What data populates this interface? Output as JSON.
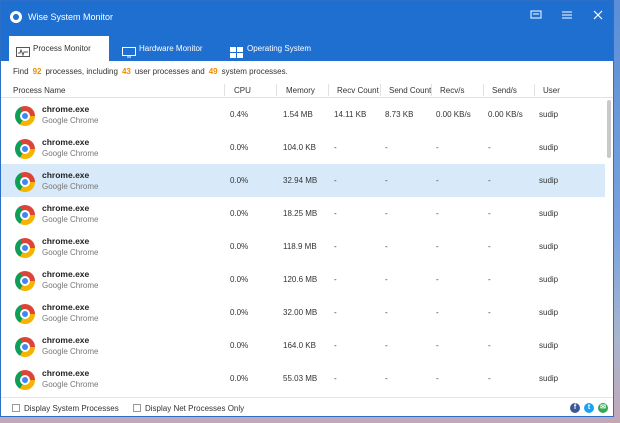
{
  "window": {
    "title": "Wise System Monitor"
  },
  "tabs": [
    {
      "label": "Process Monitor",
      "icon": "pulse-monitor-icon"
    },
    {
      "label": "Hardware Monitor",
      "icon": "computer-monitor-icon"
    },
    {
      "label": "Operating System",
      "icon": "windows-logo-icon"
    }
  ],
  "summary": {
    "prefix": "Find",
    "total": "92",
    "mid1": "processes, including",
    "user_count": "43",
    "mid2": "user processes and",
    "system_count": "49",
    "suffix": "system processes."
  },
  "columns": [
    "Process Name",
    "CPU",
    "Memory",
    "Recv Count",
    "Send Count",
    "Recv/s",
    "Send/s",
    "User"
  ],
  "processes": [
    {
      "name": "chrome.exe",
      "desc": "Google Chrome",
      "cpu": "0.4%",
      "memory": "1.54 MB",
      "recv_count": "14.11 KB",
      "send_count": "8.73 KB",
      "recv_s": "0.00 KB/s",
      "send_s": "0.00 KB/s",
      "user": "sudip"
    },
    {
      "name": "chrome.exe",
      "desc": "Google Chrome",
      "cpu": "0.0%",
      "memory": "104.0 KB",
      "recv_count": "-",
      "send_count": "-",
      "recv_s": "-",
      "send_s": "-",
      "user": "sudip"
    },
    {
      "name": "chrome.exe",
      "desc": "Google Chrome",
      "cpu": "0.0%",
      "memory": "32.94 MB",
      "recv_count": "-",
      "send_count": "-",
      "recv_s": "-",
      "send_s": "-",
      "user": "sudip"
    },
    {
      "name": "chrome.exe",
      "desc": "Google Chrome",
      "cpu": "0.0%",
      "memory": "18.25 MB",
      "recv_count": "-",
      "send_count": "-",
      "recv_s": "-",
      "send_s": "-",
      "user": "sudip"
    },
    {
      "name": "chrome.exe",
      "desc": "Google Chrome",
      "cpu": "0.0%",
      "memory": "118.9 MB",
      "recv_count": "-",
      "send_count": "-",
      "recv_s": "-",
      "send_s": "-",
      "user": "sudip"
    },
    {
      "name": "chrome.exe",
      "desc": "Google Chrome",
      "cpu": "0.0%",
      "memory": "120.6 MB",
      "recv_count": "-",
      "send_count": "-",
      "recv_s": "-",
      "send_s": "-",
      "user": "sudip"
    },
    {
      "name": "chrome.exe",
      "desc": "Google Chrome",
      "cpu": "0.0%",
      "memory": "32.00 MB",
      "recv_count": "-",
      "send_count": "-",
      "recv_s": "-",
      "send_s": "-",
      "user": "sudip"
    },
    {
      "name": "chrome.exe",
      "desc": "Google Chrome",
      "cpu": "0.0%",
      "memory": "164.0 KB",
      "recv_count": "-",
      "send_count": "-",
      "recv_s": "-",
      "send_s": "-",
      "user": "sudip"
    },
    {
      "name": "chrome.exe",
      "desc": "Google Chrome",
      "cpu": "0.0%",
      "memory": "55.03 MB",
      "recv_count": "-",
      "send_count": "-",
      "recv_s": "-",
      "send_s": "-",
      "user": "sudip"
    }
  ],
  "selected_row": 2,
  "footer": {
    "display_system_label": "Display System Processes",
    "display_net_label": "Display Net Processes Only",
    "display_system_checked": false,
    "display_net_checked": false
  },
  "colors": {
    "titlebar": "#1e6fd0",
    "accent_number": "#f08c00",
    "selected_row": "#d8eaf9"
  }
}
